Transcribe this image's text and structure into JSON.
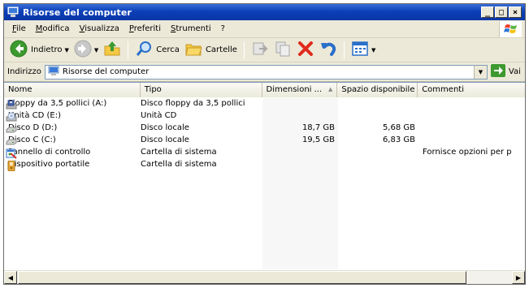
{
  "window": {
    "title": "Risorse del computer",
    "controls": [
      "_",
      "□",
      "×"
    ]
  },
  "menu": [
    "File",
    "Modifica",
    "Visualizza",
    "Preferiti",
    "Strumenti",
    "?"
  ],
  "toolbar": {
    "back_label": "Indietro",
    "search_label": "Cerca",
    "folders_label": "Cartelle"
  },
  "address": {
    "label": "Indirizzo",
    "value": "Risorse del computer",
    "go_label": "Vai"
  },
  "columns": [
    "Nome",
    "Tipo",
    "Dimensioni ...",
    "Spazio disponibile",
    "Commenti"
  ],
  "rows": [
    {
      "icon": "floppy-drive-icon",
      "name": "Floppy da 3,5 pollici (A:)",
      "type": "Disco floppy da 3,5 pollici",
      "size": "",
      "free": "",
      "comment": ""
    },
    {
      "icon": "cd-drive-icon",
      "name": "Unità CD (E:)",
      "type": "Unità CD",
      "size": "",
      "free": "",
      "comment": ""
    },
    {
      "icon": "hard-disk-icon",
      "name": "Disco D (D:)",
      "type": "Disco locale",
      "size": "18,7 GB",
      "free": "5,68 GB",
      "comment": ""
    },
    {
      "icon": "hard-disk-icon",
      "name": "Disco C (C:)",
      "type": "Disco locale",
      "size": "19,5 GB",
      "free": "6,83 GB",
      "comment": ""
    },
    {
      "icon": "control-panel-icon",
      "name": "Pannello di controllo",
      "type": "Cartella di sistema",
      "size": "",
      "free": "",
      "comment": "Fornisce opzioni per p"
    },
    {
      "icon": "portable-device-icon",
      "name": "Dispositivo portatile",
      "type": "Cartella di sistema",
      "size": "",
      "free": "",
      "comment": ""
    }
  ],
  "colors": {
    "title_bar": "#0b3fb8",
    "window_face": "#ece9d8",
    "go_arrow": "#3c9a2e"
  }
}
